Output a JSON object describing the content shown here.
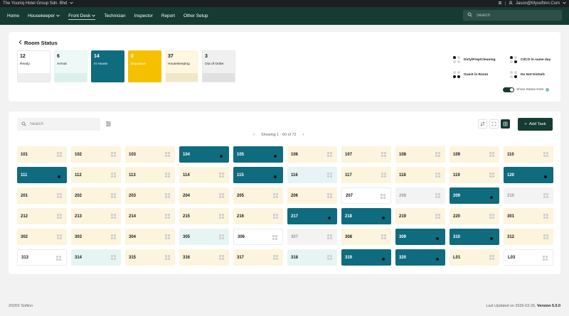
{
  "sysbar": {
    "company": "The Youniq Hotel Group Sdn. Bhd",
    "user_email": "Jason@Mysoftinn.Com"
  },
  "nav": {
    "items": [
      {
        "label": "Home",
        "dropdown": false,
        "active": false
      },
      {
        "label": "Housekeeper",
        "dropdown": true,
        "active": false
      },
      {
        "label": "Front Desk",
        "dropdown": true,
        "active": true
      },
      {
        "label": "Technician",
        "dropdown": false,
        "active": false
      },
      {
        "label": "Inspector",
        "dropdown": false,
        "active": false
      },
      {
        "label": "Report",
        "dropdown": false,
        "active": false
      },
      {
        "label": "Other Setup",
        "dropdown": false,
        "active": false
      }
    ],
    "search_placeholder": "Search"
  },
  "room_status": {
    "title": "Room Status",
    "cards": [
      {
        "count": "12",
        "label": "Ready",
        "bg": "#ffffff",
        "border": "#e6e6e6",
        "fg": "#1a1a1a",
        "strip": "#eeeeee"
      },
      {
        "count": "6",
        "label": "Arrival",
        "bg": "#eef8f6",
        "border": "#e6f2ef",
        "fg": "#1a1a1a",
        "strip": "#dcefeb"
      },
      {
        "count": "14",
        "label": "In House",
        "bg": "#0f6b7e",
        "border": "#0f6b7e",
        "fg": "#ffffff",
        "strip": "#0f6b7e"
      },
      {
        "count": "0",
        "label": "Departure",
        "bg": "#f5c000",
        "border": "#f5c000",
        "fg": "#ffffff",
        "strip": "#f5c000"
      },
      {
        "count": "37",
        "label": "Housekeeping",
        "bg": "#fdf6e0",
        "border": "#fdf6e0",
        "fg": "#1a1a1a",
        "strip": "#f0e7c8"
      },
      {
        "count": "3",
        "label": "Out of Order",
        "bg": "#f0f0f0",
        "border": "#e8e8e8",
        "fg": "#1a1a1a",
        "strip": "#e0e0e0"
      }
    ],
    "legend": [
      {
        "label": "Dirty/Prep/Cleaning",
        "dots": [
          1,
          0,
          0,
          0
        ]
      },
      {
        "label": "CI/CO in same day",
        "dots": [
          1,
          0,
          0,
          1
        ]
      },
      {
        "label": "Guest in Room",
        "dots": [
          0,
          0,
          1,
          1
        ]
      },
      {
        "label": "Do Not Disturb",
        "dots": [
          0,
          0,
          0,
          1
        ]
      }
    ],
    "show_status_dots_label": "Show Status Dots",
    "show_status_dots": true
  },
  "rooms_panel": {
    "search_placeholder": "Search",
    "pager_text": "Showing 1 - 60 of 72",
    "add_task_label": "Add Task",
    "rooms": [
      {
        "n": "101",
        "s": "hk"
      },
      {
        "n": "102",
        "s": "hk"
      },
      {
        "n": "103",
        "s": "hk"
      },
      {
        "n": "104",
        "s": "inhouse",
        "dot": true
      },
      {
        "n": "105",
        "s": "inhouse",
        "dot": true
      },
      {
        "n": "106",
        "s": "hk"
      },
      {
        "n": "107",
        "s": "hk"
      },
      {
        "n": "108",
        "s": "hk"
      },
      {
        "n": "109",
        "s": "hk"
      },
      {
        "n": "110",
        "s": "hk"
      },
      {
        "n": "111",
        "s": "inhouse",
        "dot": true
      },
      {
        "n": "112",
        "s": "hk"
      },
      {
        "n": "113",
        "s": "hk"
      },
      {
        "n": "114",
        "s": "hk"
      },
      {
        "n": "115",
        "s": "inhouse",
        "dot": true
      },
      {
        "n": "116",
        "s": "arrival"
      },
      {
        "n": "117",
        "s": "hk"
      },
      {
        "n": "118",
        "s": "hk"
      },
      {
        "n": "119",
        "s": "hk"
      },
      {
        "n": "120",
        "s": "inhouse",
        "dot": true
      },
      {
        "n": "201",
        "s": "hk"
      },
      {
        "n": "202",
        "s": "hk"
      },
      {
        "n": "203",
        "s": "hk"
      },
      {
        "n": "204",
        "s": "hk"
      },
      {
        "n": "205",
        "s": "hk"
      },
      {
        "n": "206",
        "s": "hk"
      },
      {
        "n": "207",
        "s": "ready"
      },
      {
        "n": "208",
        "s": "ooo"
      },
      {
        "n": "209",
        "s": "inhouse",
        "dot": true
      },
      {
        "n": "210",
        "s": "ooo"
      },
      {
        "n": "212",
        "s": "hk"
      },
      {
        "n": "213",
        "s": "hk"
      },
      {
        "n": "214",
        "s": "hk"
      },
      {
        "n": "215",
        "s": "hk"
      },
      {
        "n": "216",
        "s": "hk"
      },
      {
        "n": "217",
        "s": "inhouse",
        "dot": true
      },
      {
        "n": "218",
        "s": "inhouse",
        "dot": true
      },
      {
        "n": "219",
        "s": "hk"
      },
      {
        "n": "220",
        "s": "hk"
      },
      {
        "n": "301",
        "s": "hk"
      },
      {
        "n": "302",
        "s": "hk"
      },
      {
        "n": "303",
        "s": "hk"
      },
      {
        "n": "304",
        "s": "hk"
      },
      {
        "n": "305",
        "s": "arrival"
      },
      {
        "n": "306",
        "s": "ready"
      },
      {
        "n": "307",
        "s": "ooo"
      },
      {
        "n": "308",
        "s": "hk"
      },
      {
        "n": "309",
        "s": "inhouse",
        "dot": true
      },
      {
        "n": "310",
        "s": "inhouse",
        "dot": true
      },
      {
        "n": "312",
        "s": "hk"
      },
      {
        "n": "313",
        "s": "ready"
      },
      {
        "n": "314",
        "s": "arrival"
      },
      {
        "n": "315",
        "s": "hk"
      },
      {
        "n": "316",
        "s": "hk"
      },
      {
        "n": "317",
        "s": "hk"
      },
      {
        "n": "318",
        "s": "arrival"
      },
      {
        "n": "319",
        "s": "inhouse",
        "dot": true
      },
      {
        "n": "320",
        "s": "inhouse",
        "dot": true
      },
      {
        "n": "L01",
        "s": "hk"
      },
      {
        "n": "L03",
        "s": "ready"
      }
    ]
  },
  "footer": {
    "copyright": "2026© Softinn",
    "updated_prefix": "Last Updated on 2026-03-26,",
    "version": "Version 5.0.0"
  }
}
